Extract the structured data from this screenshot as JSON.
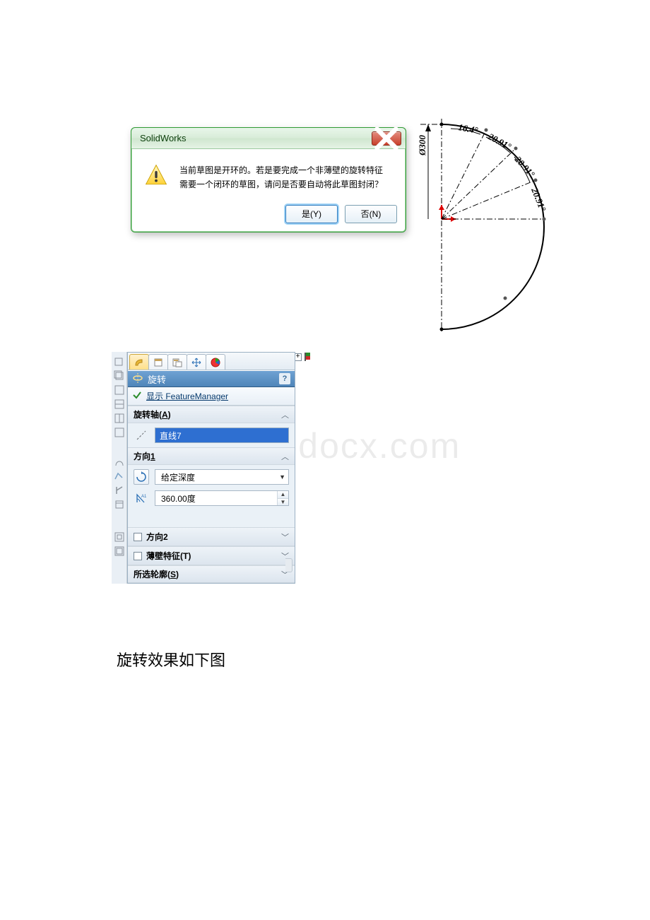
{
  "dialog": {
    "title": "SolidWorks",
    "message_line1": "当前草图是开环的。若是要完成一个非薄壁的旋转特征",
    "message_line2": "需要一个闭环的草图，请问是否要自动将此草图封闭？",
    "yes_label": "是(Y)",
    "no_label": "否(N)"
  },
  "sketch": {
    "diameter_label": "Ø300",
    "angle1": "16.4°",
    "angle2": "20.91°",
    "angle3": "20.91°",
    "angle4": "20.91°"
  },
  "pm": {
    "feature_title": "旋转",
    "help": "?",
    "fm_link": "显示 FeatureManager",
    "section_axis": {
      "label_prefix": "旋转轴(",
      "hotkey": "A",
      "label_suffix": ")"
    },
    "axis_selected": "直线7",
    "section_dir1": {
      "label_prefix": "方向",
      "hotkey": "1"
    },
    "endcond": "给定深度",
    "angle_value": "360.00度",
    "section_dir2": {
      "label_prefix": "方向",
      "hotkey": "2"
    },
    "section_thin": {
      "label_prefix": "薄壁特征(",
      "hotkey": "T",
      "label_suffix": ")"
    },
    "section_contour": {
      "label_prefix": "所选轮廓(",
      "hotkey": "S",
      "label_suffix": ")"
    }
  },
  "watermark": "www.bdocx.com",
  "caption": "旋转效果如下图"
}
